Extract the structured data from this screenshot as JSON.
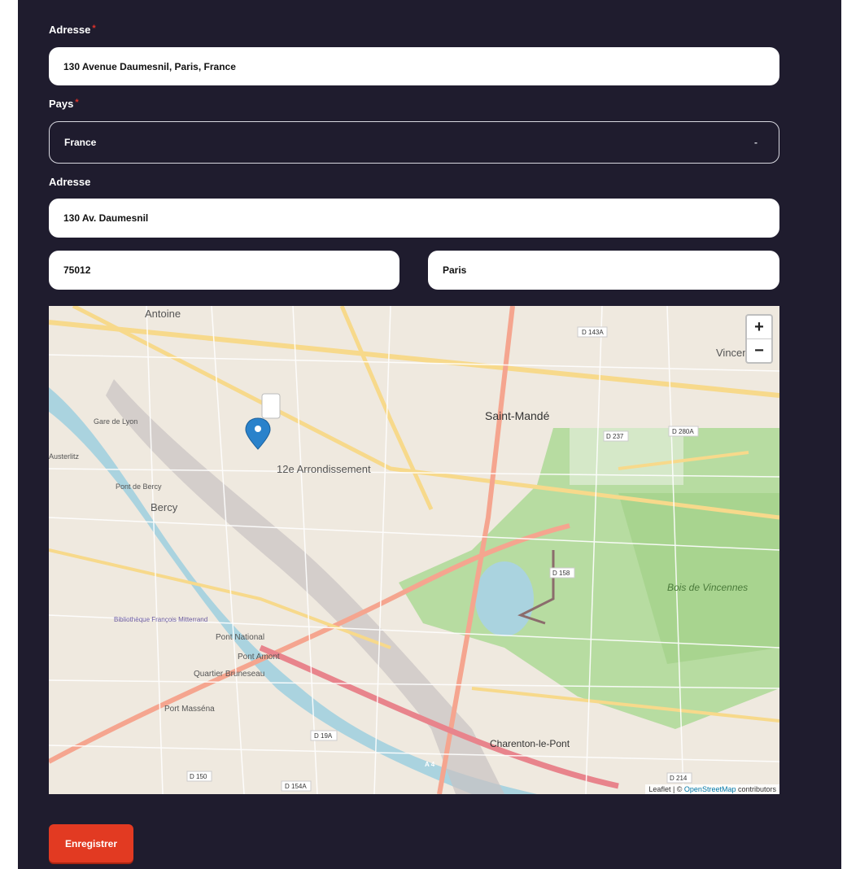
{
  "form": {
    "address_search_label": "Adresse",
    "address_search_value": "130 Avenue Daumesnil, Paris, France",
    "country_label": "Pays",
    "country_value": "France",
    "address_label": "Adresse",
    "address_value": "130 Av. Daumesnil",
    "postal_code_value": "75012",
    "city_value": "Paris",
    "required_mark": "*"
  },
  "map": {
    "zoom_in": "+",
    "zoom_out": "−",
    "attribution_prefix": "Leaflet | © ",
    "attribution_link": "OpenStreetMap",
    "attribution_suffix": " contributors",
    "place_labels": {
      "antoine": "Antoine",
      "gare_de_lyon": "Gare de Lyon",
      "saint_mande": "Saint-Mandé",
      "arrondissement": "12e Arrondissement",
      "bercy": "Bercy",
      "pont_de_bercy": "Pont de Bercy",
      "bois_de_vincennes": "Bois de Vincennes",
      "vincennes": "Vincennes",
      "pont_national": "Pont National",
      "pont_amont": "Pont Amont",
      "quartier_bruneseau": "Quartier Bruneseau",
      "bibliotheque": "Bibliothèque François Mitterrand",
      "port_massena": "Port Masséna",
      "charenton": "Charenton-le-Pont",
      "austerlitz": "Austerlitz"
    },
    "road_labels": {
      "d143a": "D 143A",
      "d237": "D 237",
      "d280a": "D 280A",
      "d158": "D 158",
      "d19a": "D 19A",
      "d150": "D 150",
      "d154a": "D 154A",
      "d214": "D 214",
      "a4": "A 4"
    }
  },
  "actions": {
    "save_label": "Enregistrer"
  },
  "colors": {
    "background": "#1f1c2e",
    "accent": "#e23a22",
    "marker": "#2a82cb"
  }
}
